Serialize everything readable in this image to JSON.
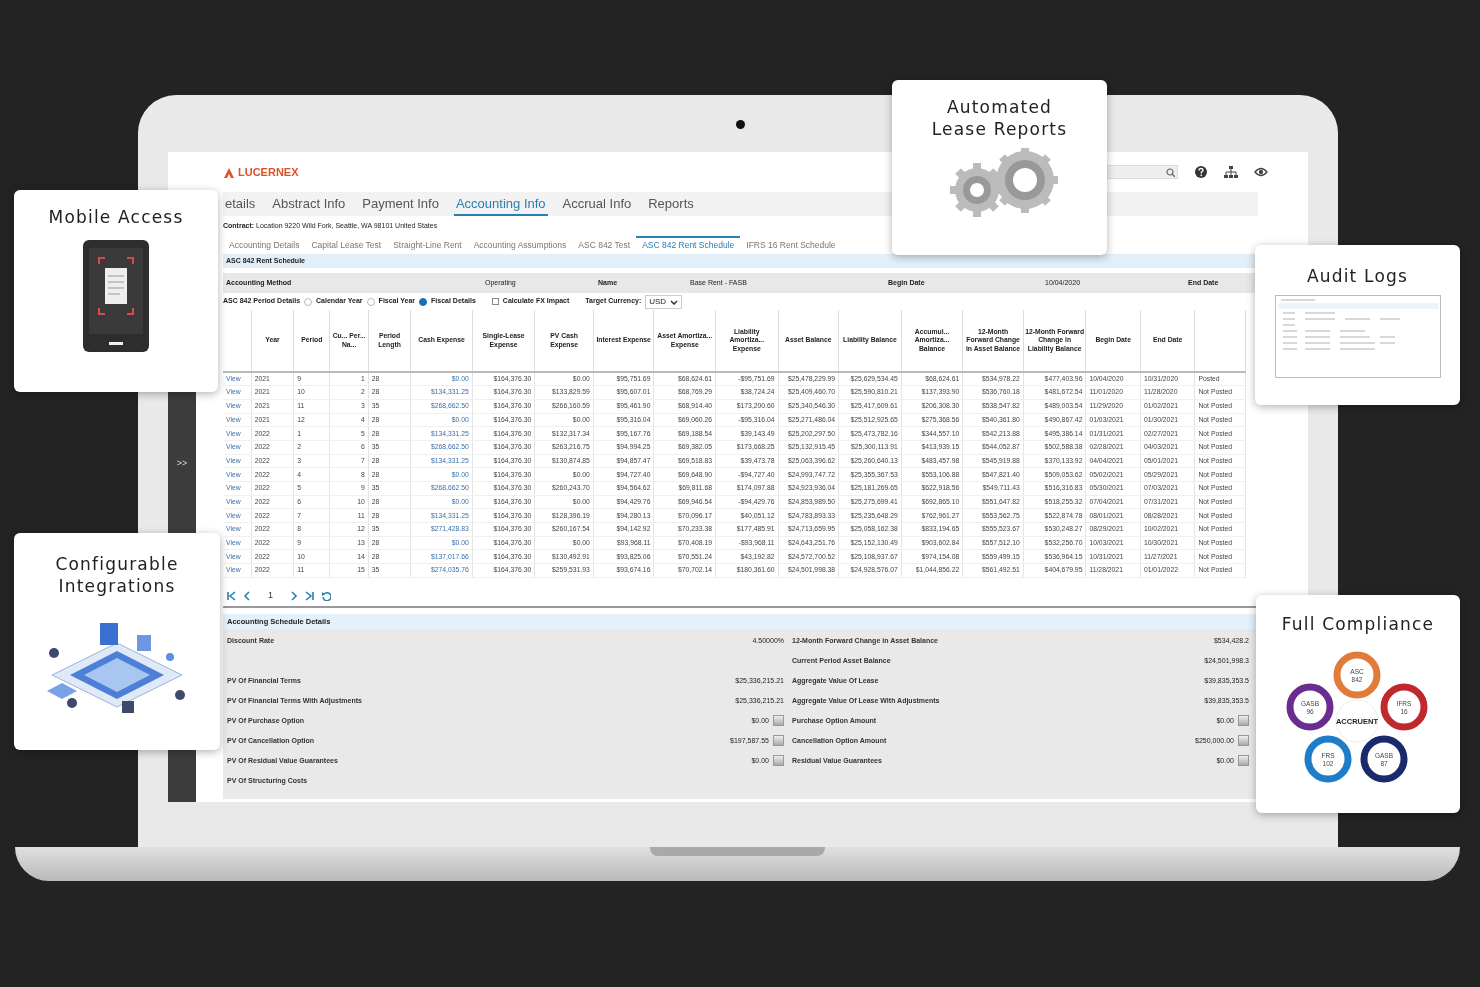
{
  "app": {
    "logo": "LUCERNEX",
    "sidebar_toggle": ">>"
  },
  "main_tabs": [
    {
      "label": "etails",
      "selected": false
    },
    {
      "label": "Abstract Info",
      "selected": false
    },
    {
      "label": "Payment Info",
      "selected": false
    },
    {
      "label": "Accounting Info",
      "selected": true
    },
    {
      "label": "Accrual Info",
      "selected": false
    },
    {
      "label": "Reports",
      "selected": false
    }
  ],
  "contract": "**Contract:** Location 9220 Wild Fork, Seattle, WA 98101 United States",
  "sub_tabs": [
    {
      "label": "Accounting Details",
      "selected": false
    },
    {
      "label": "Capital Lease Test",
      "selected": false
    },
    {
      "label": "Straight-Line Rent",
      "selected": false
    },
    {
      "label": "Accounting Assumptions",
      "selected": false
    },
    {
      "label": "ASC 842 Test",
      "selected": false
    },
    {
      "label": "ASC 842 Rent Schedule",
      "selected": true
    },
    {
      "label": "IFRS 16 Rent Schedule",
      "selected": false
    }
  ],
  "section_title": "ASC 842 Rent Schedule",
  "summary_fields": [
    {
      "label": "Accounting Method",
      "value": "Operating"
    },
    {
      "label": "Name",
      "value": "Base Rent - FASB"
    },
    {
      "label": "Begin Date",
      "value": "10/04/2020"
    },
    {
      "label": "End Date"
    }
  ],
  "period_details": {
    "label": "ASC 842 Period Details",
    "options": [
      {
        "label": "Calendar Year",
        "selected": false
      },
      {
        "label": "Fiscal Year",
        "selected": false
      },
      {
        "label": "Fiscal Details",
        "selected": true
      }
    ],
    "fx_checkbox": {
      "label": "Calculate FX Impact",
      "checked": false
    },
    "currency": {
      "label": "Target Currency:",
      "value": "USD"
    }
  },
  "table": {
    "columns": [
      {
        "kind": "link"
      },
      {
        "label": "Year",
        "kind": "text"
      },
      {
        "label": "Period",
        "kind": "text"
      },
      {
        "label": "Cu... Per... Na...",
        "kind": "number"
      },
      {
        "label": "Period Length",
        "kind": "text"
      },
      {
        "label": "Cash Expense",
        "kind": "link"
      },
      {
        "label": "Single-Lease Expense",
        "kind": "number"
      },
      {
        "label": "PV Cash Expense",
        "kind": "number"
      },
      {
        "label": "Interest Expense",
        "kind": "number"
      },
      {
        "label": "Asset Amortiza... Expense",
        "kind": "number"
      },
      {
        "label": "Liability Amortiza... Expense",
        "kind": "number"
      },
      {
        "label": "Asset Balance",
        "kind": "number"
      },
      {
        "label": "Liability Balance",
        "kind": "number"
      },
      {
        "label": "Accumul... Amortiza... Balance",
        "kind": "number"
      },
      {
        "label": "12-Month Forward Change in Asset Balance",
        "kind": "number"
      },
      {
        "label": "12-Month Forward Change in Liability Balance",
        "kind": "number"
      },
      {
        "label": "Begin Date",
        "kind": "text"
      },
      {
        "label": "End Date",
        "kind": "text"
      },
      {
        "kind": "text"
      }
    ],
    "rows": [
      [
        "View",
        "2021",
        "9",
        "1",
        "28",
        "$0.00",
        "$164,376.30",
        "$0.00",
        "$95,751.69",
        "$68,624.61",
        "-$95,751.69",
        "$25,478,229.99",
        "$25,629,534.45",
        "$68,624.61",
        "$534,978.22",
        "$477,403.96",
        "10/04/2020",
        "10/31/2020",
        "Posted"
      ],
      [
        "View",
        "2021",
        "10",
        "2",
        "28",
        "$134,331.25",
        "$164,376.30",
        "$133,829.59",
        "$95,607.01",
        "$68,769.29",
        "$38,724.24",
        "$25,409,460.70",
        "$25,590,810.21",
        "$137,393.90",
        "$536,760.18",
        "$481,672.54",
        "11/01/2020",
        "11/28/2020",
        "Not Posted"
      ],
      [
        "View",
        "2021",
        "11",
        "3",
        "35",
        "$268,662.50",
        "$164,376.30",
        "$266,160.59",
        "$95,461.90",
        "$68,914.40",
        "$173,200.60",
        "$25,340,546.30",
        "$25,417,609.61",
        "$206,308.30",
        "$538,547.82",
        "$489,003.54",
        "11/29/2020",
        "01/02/2021",
        "Not Posted"
      ],
      [
        "View",
        "2021",
        "12",
        "4",
        "28",
        "$0.00",
        "$164,376.30",
        "$0.00",
        "$95,316.04",
        "$69,060.26",
        "-$95,316.04",
        "$25,271,486.04",
        "$25,512,925.65",
        "$275,368.56",
        "$540,361.80",
        "$490,867.42",
        "01/03/2021",
        "01/30/2021",
        "Not Posted"
      ],
      [
        "View",
        "2022",
        "1",
        "5",
        "28",
        "$134,331.25",
        "$164,376.30",
        "$132,317.34",
        "$95,167.76",
        "$69,188.54",
        "$39,143.49",
        "$25,202,297.50",
        "$25,473,782.16",
        "$344,557.10",
        "$542,213.88",
        "$495,386.14",
        "01/31/2021",
        "02/27/2021",
        "Not Posted"
      ],
      [
        "View",
        "2022",
        "2",
        "6",
        "35",
        "$268,662.50",
        "$164,376.30",
        "$263,216.75",
        "$94,994.25",
        "$69,382.05",
        "$173,668.25",
        "$25,132,915.45",
        "$25,300,113.91",
        "$413,939.15",
        "$544,052.87",
        "$502,588.38",
        "02/28/2021",
        "04/03/2021",
        "Not Posted"
      ],
      [
        "View",
        "2022",
        "3",
        "7",
        "28",
        "$134,331.25",
        "$164,376.30",
        "$130,874.85",
        "$94,857.47",
        "$69,518.83",
        "$39,473.78",
        "$25,063,396.62",
        "$25,260,640.13",
        "$483,457.98",
        "$545,919.88",
        "$370,133.92",
        "04/04/2021",
        "05/01/2021",
        "Not Posted"
      ],
      [
        "View",
        "2022",
        "4",
        "8",
        "28",
        "$0.00",
        "$164,376.30",
        "$0.00",
        "$94,727.40",
        "$69,648.90",
        "-$94,727.40",
        "$24,993,747.72",
        "$25,355,367.53",
        "$553,106.88",
        "$547,821.40",
        "$509,053.62",
        "05/02/2021",
        "05/29/2021",
        "Not Posted"
      ],
      [
        "View",
        "2022",
        "5",
        "9",
        "35",
        "$268,662.50",
        "$164,376.30",
        "$260,243.70",
        "$94,564.62",
        "$69,811.68",
        "$174,097.88",
        "$24,923,936.04",
        "$25,181,269.65",
        "$622,918.56",
        "$549,711.43",
        "$516,316.83",
        "05/30/2021",
        "07/03/2021",
        "Not Posted"
      ],
      [
        "View",
        "2022",
        "6",
        "10",
        "28",
        "$0.00",
        "$164,376.30",
        "$0.00",
        "$94,429.76",
        "$69,946.54",
        "-$94,429.76",
        "$24,853,989.50",
        "$25,275,699.41",
        "$692,865.10",
        "$551,647.82",
        "$518,255.32",
        "07/04/2021",
        "07/31/2021",
        "Not Posted"
      ],
      [
        "View",
        "2022",
        "7",
        "11",
        "28",
        "$134,331.25",
        "$164,376.30",
        "$128,396.19",
        "$94,280.13",
        "$70,096.17",
        "$40,051.12",
        "$24,783,893.33",
        "$25,235,648.29",
        "$762,961.27",
        "$553,562.75",
        "$522,874.78",
        "08/01/2021",
        "08/28/2021",
        "Not Posted"
      ],
      [
        "View",
        "2022",
        "8",
        "12",
        "35",
        "$271,428.83",
        "$164,376.30",
        "$260,167.54",
        "$94,142.92",
        "$70,233.38",
        "$177,485.91",
        "$24,713,659.95",
        "$25,058,162.38",
        "$833,194.65",
        "$555,523.67",
        "$530,248.27",
        "08/29/2021",
        "10/02/2021",
        "Not Posted"
      ],
      [
        "View",
        "2022",
        "9",
        "13",
        "28",
        "$0.00",
        "$164,376.30",
        "$0.00",
        "$93,968.11",
        "$70,408.19",
        "-$93,968.11",
        "$24,643,251.76",
        "$25,152,130.49",
        "$903,602.84",
        "$557,512.10",
        "$532,256.70",
        "10/03/2021",
        "10/30/2021",
        "Not Posted"
      ],
      [
        "View",
        "2022",
        "10",
        "14",
        "28",
        "$137,017.66",
        "$164,376.30",
        "$130,492.91",
        "$93,825.06",
        "$70,551.24",
        "$43,192.82",
        "$24,572,700.52",
        "$25,108,937.67",
        "$974,154.08",
        "$559,499.15",
        "$536,964.15",
        "10/31/2021",
        "11/27/2021",
        "Not Posted"
      ],
      [
        "View",
        "2022",
        "11",
        "15",
        "35",
        "$274,035.76",
        "$164,376.30",
        "$259,531.93",
        "$93,674.16",
        "$70,702.14",
        "$180,361.60",
        "$24,501,998.38",
        "$24,928,576.07",
        "$1,044,856.22",
        "$561,492.51",
        "$404,679.95",
        "11/28/2021",
        "01/01/2022",
        "Not Posted"
      ]
    ]
  },
  "pager": {
    "page": "1"
  },
  "details": {
    "title": "Accounting Schedule Details",
    "rows": [
      {
        "left": {
          "label": "Discount Rate",
          "value": "4.50000%",
          "kind": "plain"
        },
        "right": {
          "label": "12-Month Forward Change in Asset Balance",
          "value": "$534,428.2",
          "kind": "plain"
        }
      },
      {
        "right": {
          "label": "Current Period Asset Balance",
          "value": "$24,501,998.3",
          "kind": "plain"
        }
      },
      {
        "left": {
          "label": "PV Of Financial Terms",
          "value": "$25,336,215.21",
          "kind": "plain"
        },
        "right": {
          "label": "Aggregate Value Of Lease",
          "value": "$39,835,353.5",
          "kind": "plain"
        }
      },
      {
        "left": {
          "label": "PV Of Financial Terms With Adjustments",
          "value": "$25,336,215.21",
          "kind": "plain"
        },
        "right": {
          "label": "Aggregate Value Of Lease With Adjustments",
          "value": "$39,835,353.5",
          "kind": "plain"
        }
      },
      {
        "left": {
          "label": "PV Of Purchase Option",
          "value": "$0.00",
          "kind": "calc"
        },
        "right": {
          "label": "Purchase Option Amount",
          "value": "$0.00",
          "kind": "calc"
        }
      },
      {
        "left": {
          "label": "PV Of Cancellation Option",
          "value": "$197,587.55",
          "kind": "calc"
        },
        "right": {
          "label": "Cancellation Option Amount",
          "value": "$250,000.00",
          "kind": "calc"
        }
      },
      {
        "left": {
          "label": "PV Of Residual Value Guarantees",
          "value": "$0.00",
          "kind": "calc"
        },
        "right": {
          "label": "Residual Value Guarantees",
          "value": "$0.00",
          "kind": "calc"
        }
      },
      {
        "left": {
          "label": "PV Of Structuring Costs",
          "kind": "plain"
        }
      }
    ]
  },
  "feature_cards": [
    {
      "title": "Automated Lease Reports",
      "kind": "gears"
    },
    {
      "title": "Mobile Access",
      "kind": "phone"
    },
    {
      "title": "Audit Logs",
      "kind": "audit"
    },
    {
      "title": "Configurable Integrations",
      "kind": "integrations"
    },
    {
      "title": "Full Compliance",
      "kind": "compliance",
      "center": "ACCRUENT",
      "badges": [
        {
          "label": "ASC 842",
          "color": "#e07b39"
        },
        {
          "label": "IFRS 16",
          "color": "#c0282d"
        },
        {
          "label": "GASB 87",
          "color": "#1b2a6b"
        },
        {
          "label": "FRS 102",
          "color": "#1e7cc8"
        },
        {
          "label": "GASB 96",
          "color": "#6a2c8e"
        }
      ]
    }
  ]
}
